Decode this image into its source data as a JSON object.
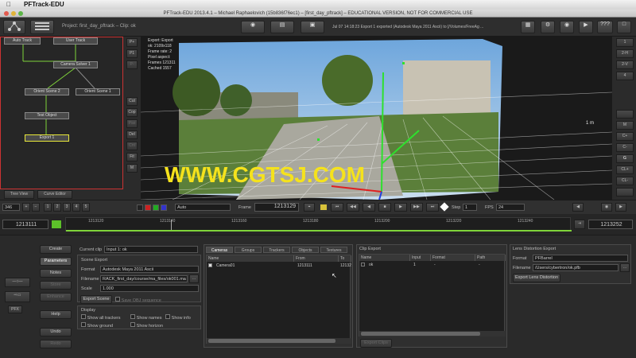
{
  "menubar": {
    "app": "PFTrack-EDU"
  },
  "window": {
    "title": "PFTrack-EDU 2013.4.1 – Michael Raphaelovich (15b836f76ec1) – [first_day_pftrack] – EDUCATIONAL VERSION, NOT FOR COMMERCIAL USE"
  },
  "toolbar": {
    "project": "Project: first_day_pftrack – Clip: ok",
    "status": "Jul 07 14:18:23 Export 1 exported (Autodesk Maya 2011 Ascii) to [/Volumes/FreeAg ...",
    "help": "???"
  },
  "nodes": {
    "auto_track": "Auto Track",
    "user_track": "User Track",
    "camera_solver": "Camera Solver 1",
    "orient_2": "Orient Scene 2",
    "orient_1": "Orient Scene 1",
    "test_object": "Test Object",
    "export": "Export 1"
  },
  "node_tabs": {
    "tree": "Tree View",
    "curve": "Curve Editor"
  },
  "node_buttons": [
    "P+",
    "P1",
    "P-",
    "Cut",
    "Cop",
    "Pas",
    "Del",
    "Cnt",
    "Fit",
    "M"
  ],
  "viewer": {
    "info": [
      "Export: Export",
      "ok: 2109x118",
      "Frame rate: 2",
      "Pixel aspect:",
      "Frames 121311",
      "Cached 1557"
    ],
    "scale_label": "1 m",
    "watermark": "WWW.CGTSJ.COM"
  },
  "right_strip": [
    "1",
    "2-H",
    "2-V",
    "4",
    "",
    "M",
    "C+",
    "C-",
    "G",
    "CL+",
    "CL-",
    ""
  ],
  "timebar": {
    "zoom": "346",
    "ticks": [
      "1",
      "2",
      "3",
      "4",
      "5"
    ],
    "mode": "Auto",
    "frame_label": "Frame",
    "frame": "1213129",
    "step_label": "Step",
    "step": "1",
    "fps_label": "FPS",
    "fps": "24"
  },
  "timeline": {
    "start": "1213111",
    "end": "1213252",
    "ticks": [
      "1213120",
      "1213140",
      "1213160",
      "1213180",
      "1213200",
      "1213220",
      "1213240"
    ]
  },
  "sidebar": {
    "create": "Create",
    "parameters": "Parameters",
    "notes": "Notes",
    "store": "Store",
    "enhance": "Enhance",
    "help": "Help",
    "undo": "Undo",
    "redo": "Redo"
  },
  "params": {
    "current_clip_label": "Current clip",
    "current_clip": "Input 1: ok",
    "scene_export": "Scene Export",
    "format_label": "Format",
    "format": "Autodesk Maya 2011 Ascii",
    "filename_label": "Filename",
    "filename": "RACK_first_day/course/ma_files/ok001.ma",
    "scale_label": "Scale",
    "scale": "1.000",
    "export_scene": "Export Scene",
    "save_obj": "Save OBJ sequence",
    "display": "Display",
    "show_all_trackers": "Show all trackers",
    "show_names": "Show names",
    "show_info": "Show info",
    "show_ground": "Show ground",
    "show_horizon": "Show horizon"
  },
  "cameras": {
    "tabs": [
      "Cameras",
      "Groups",
      "Trackers",
      "Objects",
      "Textures"
    ],
    "headers": [
      "Name",
      "From",
      "To"
    ],
    "rows": [
      {
        "name": "Camera01",
        "from": "1213111",
        "to": "12132"
      }
    ]
  },
  "clip_export": {
    "title": "Clip Export",
    "headers": [
      "Name",
      "Input",
      "Format",
      "Path"
    ],
    "rows": [
      {
        "name": "ok",
        "input": "1",
        "format": "-",
        "path": "-"
      }
    ],
    "button": "Export Clips"
  },
  "lens": {
    "title": "Lens Distortion Export",
    "format_label": "Format",
    "format": "PFBarrel",
    "filename_label": "Filename",
    "filename": "/Users/cybertron/ok.pfb",
    "button": "Export Lens Distortion"
  },
  "colors": {
    "accent_green": "#7fd43a",
    "node_border": "#c33",
    "watermark": "#f5e21c"
  }
}
